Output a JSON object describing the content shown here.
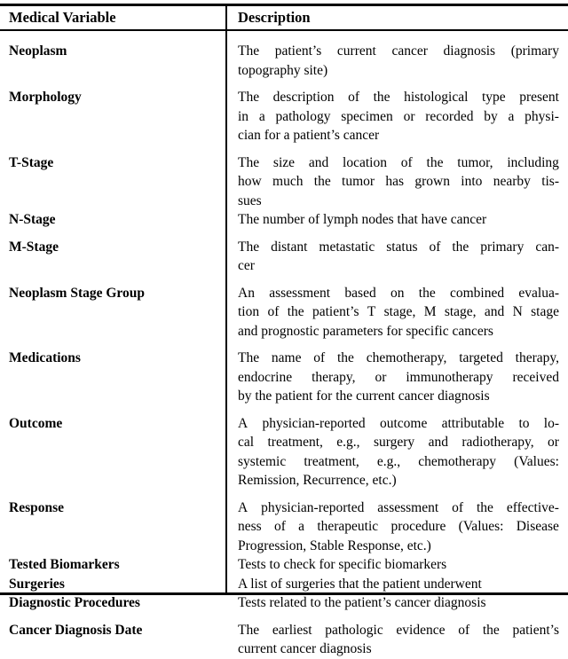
{
  "table": {
    "columns": [
      {
        "key": "variable",
        "label": "Medical Variable"
      },
      {
        "key": "description",
        "label": "Description"
      }
    ],
    "rows": [
      {
        "variable": "Neoplasm",
        "description": "The patient’s current cancer diagnosis (primary topography site)",
        "lines": [
          "The patient’s current cancer diagnosis (primary",
          "topography site)"
        ]
      },
      {
        "variable": "Morphology",
        "description": "The description of the histological type present in a pathology specimen or recorded by a physician for a patient’s cancer",
        "lines": [
          "The description of the histological type present",
          "in a pathology specimen or recorded by a physi-",
          "cian for a patient’s cancer"
        ]
      },
      {
        "variable": "T-Stage",
        "description": "The size and location of the tumor, including how much the tumor has grown into nearby tissues",
        "lines": [
          "The size and location of the tumor, including",
          "how much the tumor has grown into nearby tis-",
          "sues"
        ]
      },
      {
        "variable": "N-Stage",
        "description": "The number of lymph nodes that have cancer",
        "lines": [
          "The number of lymph nodes that have cancer"
        ]
      },
      {
        "variable": "M-Stage",
        "description": "The distant metastatic status of the primary cancer",
        "lines": [
          "The distant metastatic status of the primary can-",
          "cer"
        ]
      },
      {
        "variable": "Neoplasm Stage Group",
        "description": "An assessment based on the combined evaluation of the patient’s T stage, M stage, and N stage and prognostic parameters for specific cancers",
        "lines": [
          "An assessment based on the combined evalua-",
          "tion of the patient’s T stage, M stage, and N stage",
          "and prognostic parameters for specific cancers"
        ]
      },
      {
        "variable": "Medications",
        "description": "The name of the chemotherapy, targeted therapy, endocrine therapy, or immunotherapy received by the patient for the current cancer diagnosis",
        "lines": [
          "The name of the chemotherapy, targeted therapy,",
          "endocrine therapy, or immunotherapy received",
          "by the patient for the current cancer diagnosis"
        ]
      },
      {
        "variable": "Outcome",
        "description": "A physician-reported outcome attributable to local treatment, e.g., surgery and radiotherapy, or systemic treatment, e.g., chemotherapy (Values: Remission, Recurrence, etc.)",
        "lines": [
          "A physician-reported outcome attributable to lo-",
          "cal treatment, e.g., surgery and radiotherapy, or",
          "systemic treatment, e.g., chemotherapy (Values:",
          "Remission, Recurrence, etc.)"
        ]
      },
      {
        "variable": "Response",
        "description": "A physician-reported assessment of the effectiveness of a therapeutic procedure (Values: Disease Progression, Stable Response, etc.)",
        "lines": [
          "A physician-reported assessment of the effective-",
          "ness of a therapeutic procedure (Values: Disease",
          "Progression, Stable Response, etc.)"
        ]
      },
      {
        "variable": "Tested Biomarkers",
        "description": "Tests to check for specific biomarkers",
        "lines": [
          "Tests to check for specific biomarkers"
        ]
      },
      {
        "variable": "Surgeries",
        "description": "A list of surgeries that the patient underwent",
        "lines": [
          "A list of surgeries that the patient underwent"
        ]
      },
      {
        "variable": "Diagnostic Procedures",
        "description": "Tests related to the patient’s cancer diagnosis",
        "lines": [
          "Tests related to the patient’s cancer diagnosis"
        ]
      },
      {
        "variable": "Cancer Diagnosis Date",
        "description": "The earliest pathologic evidence of the patient’s current cancer diagnosis",
        "lines": [
          "The earliest pathologic evidence of the patient’s",
          "current cancer diagnosis"
        ]
      }
    ]
  }
}
